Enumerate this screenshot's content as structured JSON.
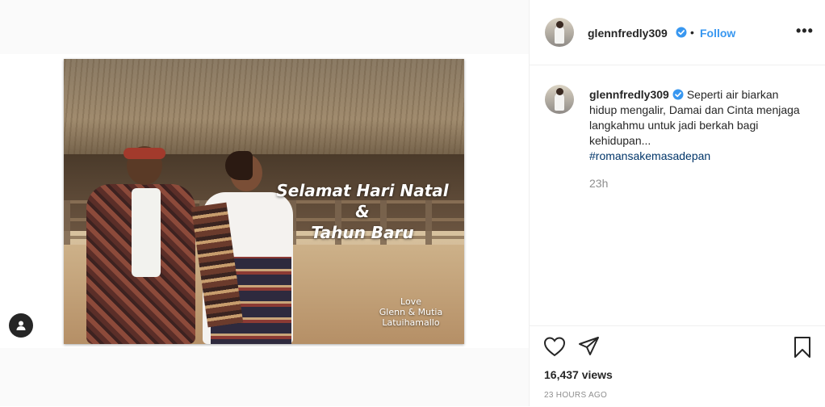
{
  "post": {
    "image_overlay": {
      "line1": "Selamat Hari Natal",
      "line2": "&",
      "line3": "Tahun Baru",
      "love_line1": "Love",
      "love_line2": "Glenn & Mutia",
      "love_line3": "Latuihamallo"
    }
  },
  "header": {
    "username": "glennfredly309",
    "separator": "•",
    "follow_label": "Follow",
    "more_icon": "more-options-icon",
    "more_label": "•••"
  },
  "caption": {
    "username": "glennfredly309",
    "text": "Seperti air biarkan hidup mengalir, Damai dan Cinta menjaga langkahmu untuk jadi berkah bagi kehidupan...",
    "hashtag": "#romansakemasadepan",
    "relative_time": "23h"
  },
  "actions": {
    "like_icon": "heart-icon",
    "share_icon": "paper-plane-icon",
    "save_icon": "bookmark-icon",
    "views": "16,437 views",
    "timestamp": "23 HOURS AGO"
  },
  "colors": {
    "accent": "#3897f0",
    "hashtag": "#003569",
    "muted": "#8e8e8e",
    "text": "#262626"
  }
}
